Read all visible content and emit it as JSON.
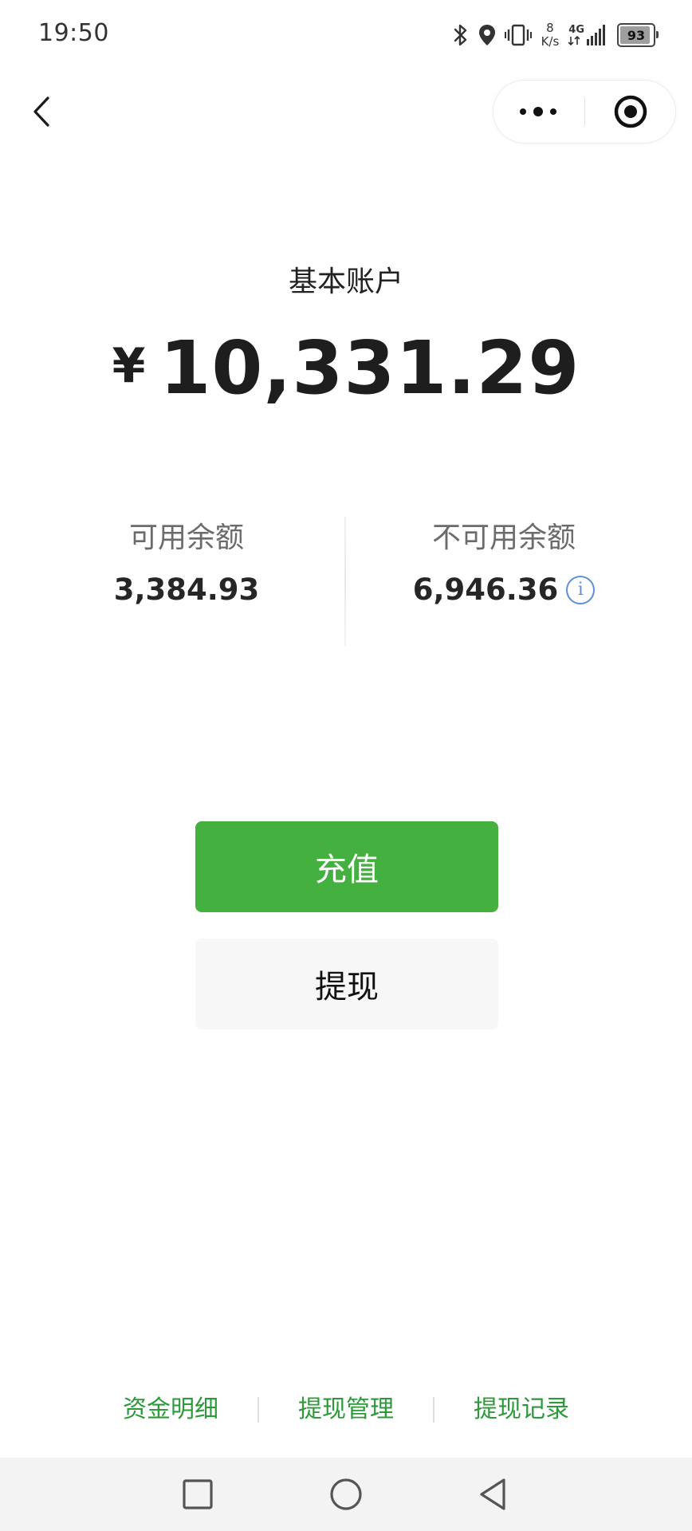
{
  "status_bar": {
    "time": "19:50",
    "speed_value": "8",
    "speed_unit": "K/s",
    "network": "4G",
    "battery_level": "93",
    "battery_percent": 93,
    "icons": [
      "bluetooth-icon",
      "location-icon",
      "vibrate-icon",
      "signal-icon",
      "battery-icon"
    ]
  },
  "nav": {
    "back_icon": "chevron-left-icon",
    "more_icon": "more-dots-icon",
    "close_icon": "target-circle-icon"
  },
  "account": {
    "title": "基本账户",
    "currency_symbol": "¥",
    "total_balance": "10,331.29"
  },
  "balances": {
    "available_label": "可用余额",
    "available_value": "3,384.93",
    "unavailable_label": "不可用余额",
    "unavailable_value": "6,946.36",
    "info_icon": "info-icon"
  },
  "actions": {
    "recharge_label": "充值",
    "withdraw_label": "提现"
  },
  "footer_links": {
    "fund_details": "资金明细",
    "withdraw_management": "提现管理",
    "withdraw_records": "提现记录"
  },
  "colors": {
    "primary_green": "#43b040",
    "link_green": "#2c9a3a",
    "info_blue": "#5f8fd8"
  }
}
